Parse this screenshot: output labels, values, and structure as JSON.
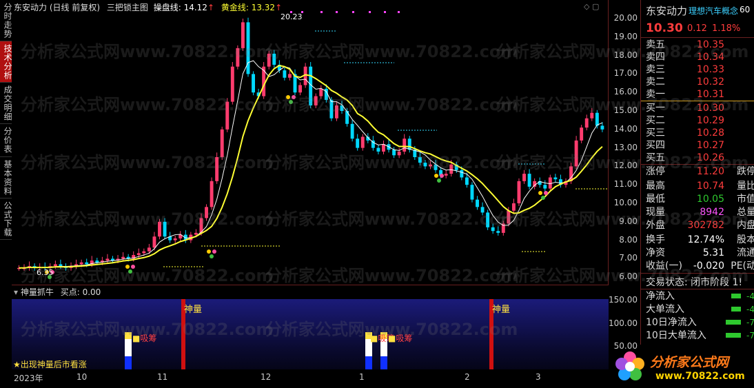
{
  "side_tabs": [
    "分时走势",
    "技术分析",
    "成交明细",
    "分价表",
    "基本资料",
    "公式下载"
  ],
  "header": {
    "stock": "东安动力",
    "period": "(日线 前复权)",
    "indicator": "三把锁主图",
    "line1_label": "操盘线:",
    "line1_value": "14.12",
    "line2_label": "黄金线:",
    "line2_value": "13.32",
    "arrow": "↑"
  },
  "watermark": "分析家公式网www.70822.com",
  "price_ticks": [
    "20.00",
    "19.00",
    "18.00",
    "17.00",
    "16.00",
    "15.00",
    "14.00",
    "13.00",
    "12.00",
    "11.00",
    "10.00",
    "9.00",
    "8.00",
    "7.00",
    "6.00"
  ],
  "annotations": {
    "high": "20.23",
    "low": "6.35"
  },
  "quote": {
    "name": "东安动力",
    "concept": "理想汽车概念",
    "code_suffix": "60",
    "price": "10.30",
    "change": "0.12",
    "change_pct": "1.18%",
    "asks": [
      {
        "label": "卖五",
        "price": "10.35"
      },
      {
        "label": "卖四",
        "price": "10.34"
      },
      {
        "label": "卖三",
        "price": "10.33"
      },
      {
        "label": "卖二",
        "price": "10.32"
      },
      {
        "label": "卖一",
        "price": "10.31"
      }
    ],
    "bids": [
      {
        "label": "买一",
        "price": "10.30"
      },
      {
        "label": "买二",
        "price": "10.29"
      },
      {
        "label": "买三",
        "price": "10.28"
      },
      {
        "label": "买四",
        "price": "10.27"
      },
      {
        "label": "买五",
        "price": "10.26"
      }
    ],
    "stats": [
      {
        "label": "涨停",
        "value": "11.20",
        "right": "跌停",
        "color": "#ff3c3c"
      },
      {
        "label": "最高",
        "value": "10.74",
        "right": "量比",
        "color": "#ff3c3c"
      },
      {
        "label": "最低",
        "value": "10.05",
        "right": "市值",
        "color": "#2ec82e"
      },
      {
        "label": "现量",
        "value": "8942",
        "right": "总量",
        "color": "#ff55ff"
      },
      {
        "label": "外盘",
        "value": "302782",
        "right": "内盘",
        "color": "#ff3c3c"
      },
      {
        "label": "换手",
        "value": "12.74%",
        "right": "股本",
        "color": "#ffffff"
      },
      {
        "label": "净资",
        "value": "5.31",
        "right": "流通",
        "color": "#ffffff"
      },
      {
        "label": "收益(一)",
        "value": "-0.020",
        "right": "PE(动",
        "color": "#ffffff"
      }
    ],
    "trade_status": "交易状态: 闭市阶段 1!",
    "flows": [
      {
        "label": "净流入",
        "value": "-4"
      },
      {
        "label": "大单流入",
        "value": "-4"
      },
      {
        "label": "10日净流入",
        "value": "-7"
      },
      {
        "label": "10日大单流入",
        "value": "-7"
      }
    ]
  },
  "indicator_panel": {
    "title": "神量抓牛",
    "buy_label": "买点:",
    "buy_value": "0.00",
    "ticks": [
      "150.00",
      "100.00",
      "50.00"
    ],
    "tag_volume": "神量",
    "tag_absorb": "吸筹",
    "note": "★出现神量后市看涨"
  },
  "dates": [
    "2023年",
    "10",
    "11",
    "12",
    "1",
    "2",
    "3"
  ],
  "logo": {
    "text": "分析家公式网",
    "url": "www.70822.com"
  },
  "colors": {
    "up": "#ff3c6e",
    "down": "#00d8ff",
    "ma_fast": "#ffffff",
    "ma_slow": "#ffff33",
    "accent_red": "#b01010"
  }
}
